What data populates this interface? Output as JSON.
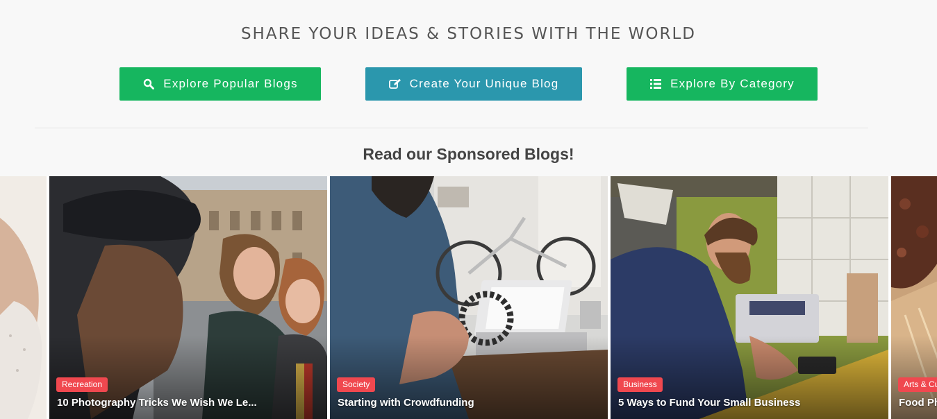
{
  "hero": {
    "headline": "SHARE YOUR IDEAS & STORIES WITH THE WORLD",
    "buttons": [
      {
        "label": "Explore Popular Blogs",
        "icon": "search-icon",
        "color": "#16b65f"
      },
      {
        "label": "Create Your Unique Blog",
        "icon": "edit-icon",
        "color": "#2b97ad"
      },
      {
        "label": "Explore By Category",
        "icon": "list-icon",
        "color": "#16b65f"
      }
    ],
    "subheading": "Read our Sponsored Blogs!"
  },
  "sponsored": {
    "cards": [
      {
        "category": "",
        "title": ""
      },
      {
        "category": "Recreation",
        "title": "10 Photography Tricks We Wish We Le..."
      },
      {
        "category": "Society",
        "title": "Starting with Crowdfunding"
      },
      {
        "category": "Business",
        "title": "5 Ways to Fund Your Small Business"
      },
      {
        "category": "Arts & Cu",
        "title": "Food Ph"
      }
    ],
    "tag_color": "#f0484f"
  }
}
